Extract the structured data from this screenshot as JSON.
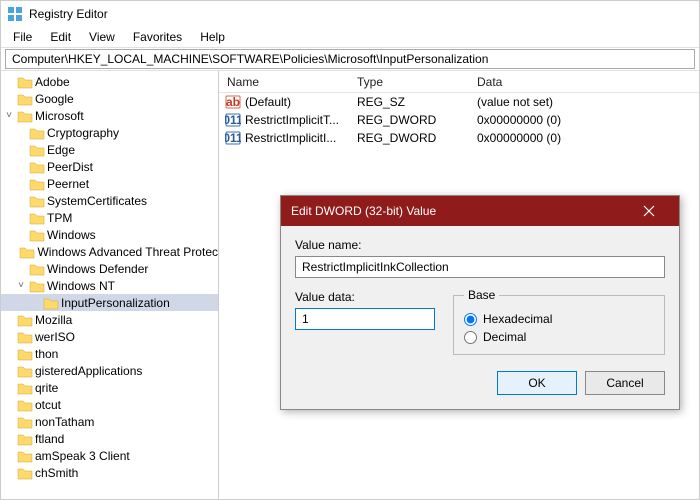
{
  "window": {
    "title": "Registry Editor"
  },
  "menu": {
    "file": "File",
    "edit": "Edit",
    "view": "View",
    "favorites": "Favorites",
    "help": "Help"
  },
  "address": {
    "path": "Computer\\HKEY_LOCAL_MACHINE\\SOFTWARE\\Policies\\Microsoft\\InputPersonalization"
  },
  "tree": {
    "items": [
      {
        "depth": 0,
        "twisty": "",
        "label": "Adobe"
      },
      {
        "depth": 0,
        "twisty": "",
        "label": "Google"
      },
      {
        "depth": 0,
        "twisty": "˅",
        "label": "Microsoft"
      },
      {
        "depth": 1,
        "twisty": "",
        "label": "Cryptography"
      },
      {
        "depth": 1,
        "twisty": "",
        "label": "Edge"
      },
      {
        "depth": 1,
        "twisty": "",
        "label": "PeerDist"
      },
      {
        "depth": 1,
        "twisty": "",
        "label": "Peernet"
      },
      {
        "depth": 1,
        "twisty": "",
        "label": "SystemCertificates"
      },
      {
        "depth": 1,
        "twisty": "",
        "label": "TPM"
      },
      {
        "depth": 1,
        "twisty": "",
        "label": "Windows"
      },
      {
        "depth": 1,
        "twisty": "",
        "label": "Windows Advanced Threat Protec"
      },
      {
        "depth": 1,
        "twisty": "",
        "label": "Windows Defender"
      },
      {
        "depth": 1,
        "twisty": "˅",
        "label": "Windows NT"
      },
      {
        "depth": 2,
        "twisty": "",
        "label": "InputPersonalization",
        "selected": true
      },
      {
        "depth": 0,
        "twisty": "",
        "label": "Mozilla"
      },
      {
        "depth": 0,
        "twisty": "",
        "label": "werISO"
      },
      {
        "depth": 0,
        "twisty": "",
        "label": "thon"
      },
      {
        "depth": 0,
        "twisty": "",
        "label": "gisteredApplications"
      },
      {
        "depth": 0,
        "twisty": "",
        "label": "qrite"
      },
      {
        "depth": 0,
        "twisty": "",
        "label": "otcut"
      },
      {
        "depth": 0,
        "twisty": "",
        "label": "nonTatham"
      },
      {
        "depth": 0,
        "twisty": "",
        "label": "ftland"
      },
      {
        "depth": 0,
        "twisty": "",
        "label": "amSpeak 3 Client"
      },
      {
        "depth": 0,
        "twisty": "",
        "label": "chSmith"
      }
    ]
  },
  "valuesHeader": {
    "name": "Name",
    "type": "Type",
    "data": "Data"
  },
  "values": [
    {
      "icon": "sz",
      "name": "(Default)",
      "type": "REG_SZ",
      "data": "(value not set)"
    },
    {
      "icon": "dw",
      "name": "RestrictImplicitT...",
      "type": "REG_DWORD",
      "data": "0x00000000 (0)"
    },
    {
      "icon": "dw",
      "name": "RestrictImplicitI...",
      "type": "REG_DWORD",
      "data": "0x00000000 (0)"
    }
  ],
  "dialog": {
    "title": "Edit DWORD (32-bit) Value",
    "valueNameLabel": "Value name:",
    "valueName": "RestrictImplicitInkCollection",
    "valueDataLabel": "Value data:",
    "valueData": "1",
    "baseLegend": "Base",
    "hexLabel": "Hexadecimal",
    "decLabel": "Decimal",
    "ok": "OK",
    "cancel": "Cancel"
  }
}
